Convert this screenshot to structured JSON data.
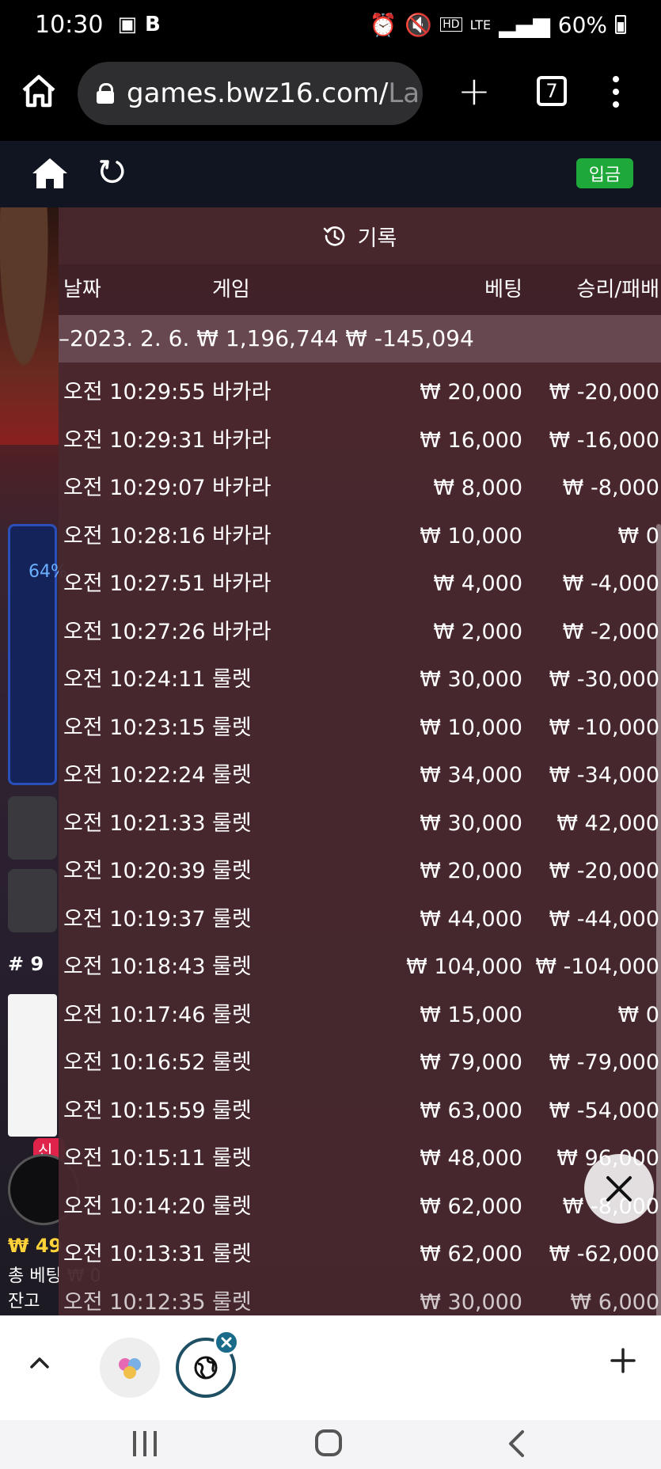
{
  "status_bar": {
    "time": "10:30",
    "battery": "60%",
    "icons": [
      "gallery-icon",
      "b-app-icon",
      "alarm-icon",
      "mute-icon",
      "hd-voice-icon",
      "lte-icon",
      "signal-icon",
      "battery-icon"
    ]
  },
  "browser": {
    "url_main": "games.bwz16.com/",
    "url_rest": "La",
    "tab_count": "7"
  },
  "app_header": {
    "deposit_label": "입금"
  },
  "background": {
    "percent": "64%",
    "table_no": "# 9",
    "new_badge": "신규",
    "money": "₩ 49",
    "total_bet_label": "총 베팅",
    "balance_label": "잔고",
    "win_label": "₩ 0"
  },
  "history": {
    "title": "기록",
    "headers": {
      "date": "날짜",
      "game": "게임",
      "bet": "베팅",
      "win_loss": "승리/패배"
    },
    "day": {
      "date": "–2023. 2. 6.",
      "bet_total": "₩ 1,196,744",
      "win_total": "₩ -145,094"
    },
    "rows": [
      {
        "time": "오전 10:29:55",
        "game": "바카라",
        "bet": "₩ 20,000",
        "result": "₩ -20,000"
      },
      {
        "time": "오전 10:29:31",
        "game": "바카라",
        "bet": "₩ 16,000",
        "result": "₩ -16,000"
      },
      {
        "time": "오전 10:29:07",
        "game": "바카라",
        "bet": "₩ 8,000",
        "result": "₩ -8,000"
      },
      {
        "time": "오전 10:28:16",
        "game": "바카라",
        "bet": "₩ 10,000",
        "result": "₩ 0"
      },
      {
        "time": "오전 10:27:51",
        "game": "바카라",
        "bet": "₩ 4,000",
        "result": "₩ -4,000"
      },
      {
        "time": "오전 10:27:26",
        "game": "바카라",
        "bet": "₩ 2,000",
        "result": "₩ -2,000"
      },
      {
        "time": "오전 10:24:11",
        "game": "룰렛",
        "bet": "₩ 30,000",
        "result": "₩ -30,000"
      },
      {
        "time": "오전 10:23:15",
        "game": "룰렛",
        "bet": "₩ 10,000",
        "result": "₩ -10,000"
      },
      {
        "time": "오전 10:22:24",
        "game": "룰렛",
        "bet": "₩ 34,000",
        "result": "₩ -34,000"
      },
      {
        "time": "오전 10:21:33",
        "game": "룰렛",
        "bet": "₩ 30,000",
        "result": "₩ 42,000"
      },
      {
        "time": "오전 10:20:39",
        "game": "룰렛",
        "bet": "₩ 20,000",
        "result": "₩ -20,000"
      },
      {
        "time": "오전 10:19:37",
        "game": "룰렛",
        "bet": "₩ 44,000",
        "result": "₩ -44,000"
      },
      {
        "time": "오전 10:18:43",
        "game": "룰렛",
        "bet": "₩ 104,000",
        "result": "₩ -104,000"
      },
      {
        "time": "오전 10:17:46",
        "game": "룰렛",
        "bet": "₩ 15,000",
        "result": "₩ 0"
      },
      {
        "time": "오전 10:16:52",
        "game": "룰렛",
        "bet": "₩ 79,000",
        "result": "₩ -79,000"
      },
      {
        "time": "오전 10:15:59",
        "game": "룰렛",
        "bet": "₩ 63,000",
        "result": "₩ -54,000"
      },
      {
        "time": "오전 10:15:11",
        "game": "룰렛",
        "bet": "₩ 48,000",
        "result": "₩ 96,000"
      },
      {
        "time": "오전 10:14:20",
        "game": "룰렛",
        "bet": "₩ 62,000",
        "result": "₩ -8,000"
      },
      {
        "time": "오전 10:13:31",
        "game": "룰렛",
        "bet": "₩ 62,000",
        "result": "₩ -62,000"
      },
      {
        "time": "오전 10:12:35",
        "game": "룰렛",
        "bet": "₩ 30,000",
        "result": "₩ 6,000"
      }
    ]
  }
}
